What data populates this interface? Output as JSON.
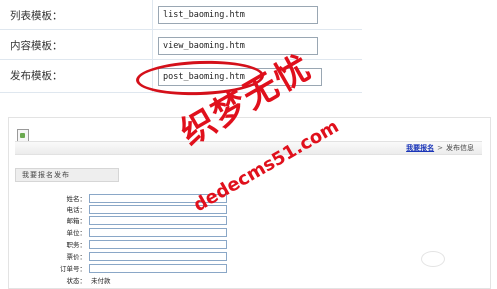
{
  "settings": {
    "rows": [
      {
        "label": "列表模板：",
        "value": "list_baoming.htm"
      },
      {
        "label": "内容模板：",
        "value": "view_baoming.htm"
      },
      {
        "label": "发布模板：",
        "value": "post_baoming.htm"
      }
    ]
  },
  "breadcrumb": {
    "link": "我要报名",
    "separator": ">",
    "current": "发布信息"
  },
  "form": {
    "title": "我要报名发布",
    "fields": [
      {
        "label": "姓名：",
        "value": ""
      },
      {
        "label": "电话：",
        "value": ""
      },
      {
        "label": "邮箱：",
        "value": ""
      },
      {
        "label": "单位：",
        "value": ""
      },
      {
        "label": "职务：",
        "value": ""
      },
      {
        "label": "票价：",
        "value": ""
      },
      {
        "label": "订单号：",
        "value": ""
      },
      {
        "label": "状态：",
        "value": "未付款"
      }
    ]
  },
  "watermark": {
    "cn": "织梦无忧",
    "url": "dedecms51.com"
  },
  "colors": {
    "highlight": "#d4101a",
    "watermark": "#e0101c",
    "link": "#1a35b8"
  }
}
